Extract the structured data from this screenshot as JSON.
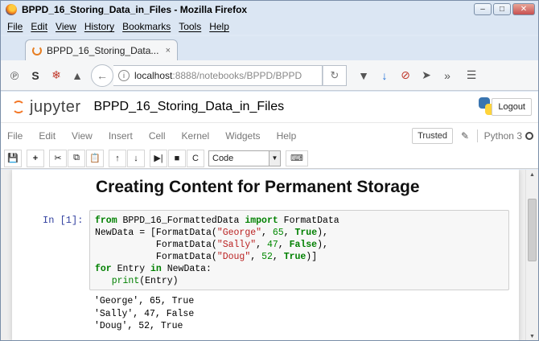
{
  "window": {
    "title": "BPPD_16_Storing_Data_in_Files - Mozilla Firefox"
  },
  "menubar": [
    "File",
    "Edit",
    "View",
    "History",
    "Bookmarks",
    "Tools",
    "Help"
  ],
  "tab": {
    "title": "BPPD_16_Storing_Data...",
    "close": "×"
  },
  "url": {
    "host": "localhost",
    "rest": ":8888/notebooks/BPPD/BPPD"
  },
  "jupyter": {
    "logo": "jupyter",
    "notebook_title": "BPPD_16_Storing_Data_in_Files",
    "logout": "Logout",
    "menu": [
      "File",
      "Edit",
      "View",
      "Insert",
      "Cell",
      "Kernel",
      "Widgets",
      "Help"
    ],
    "trusted": "Trusted",
    "kernel": "Python 3",
    "cell_type": "Code"
  },
  "notebook": {
    "heading": "Creating Content for Permanent Storage",
    "prompt": "In [1]:",
    "code_lines": [
      "from BPPD_16_FormattedData import FormatData",
      "NewData = [FormatData(\"George\", 65, True),",
      "           FormatData(\"Sally\", 47, False),",
      "           FormatData(\"Doug\", 52, True)]",
      "for Entry in NewData:",
      "   print(Entry)"
    ],
    "output_lines": [
      "'George', 65, True",
      "'Sally', 47, False",
      "'Doug', 52, True"
    ]
  },
  "icons": [
    "firefox-logo",
    "minimize",
    "maximize",
    "close",
    "rss",
    "stylish",
    "ext",
    "back-arrow",
    "info",
    "reload",
    "pocket",
    "download",
    "block",
    "send",
    "overflow",
    "hamburger-menu",
    "save",
    "plus",
    "cut",
    "copy",
    "paste",
    "up",
    "down",
    "run",
    "stop",
    "restart",
    "keyboard"
  ]
}
